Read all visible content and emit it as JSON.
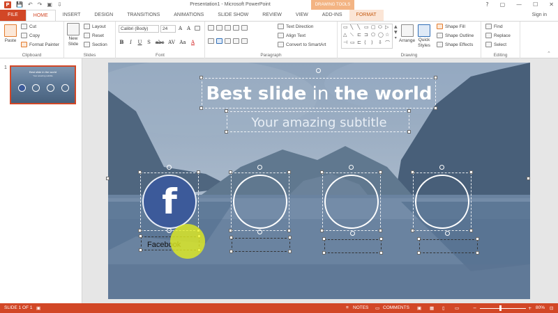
{
  "window": {
    "title": "Presentation1 - Microsoft PowerPoint",
    "app_icon": "P",
    "contextual_header": "DRAWING TOOLS",
    "signin": "Sign in",
    "controls": [
      "?",
      "▢",
      "—",
      "☐",
      "✕"
    ]
  },
  "quick_access": [
    "💾",
    "↶",
    "↷",
    "▣",
    "⇩"
  ],
  "tabs": [
    "FILE",
    "HOME",
    "INSERT",
    "DESIGN",
    "TRANSITIONS",
    "ANIMATIONS",
    "SLIDE SHOW",
    "REVIEW",
    "VIEW",
    "ADD-INS",
    "FORMAT"
  ],
  "ribbon": {
    "clipboard": {
      "label": "Clipboard",
      "paste": "Paste",
      "cut": "Cut",
      "copy": "Copy",
      "format_painter": "Format Painter"
    },
    "slides": {
      "label": "Slides",
      "new_slide_1": "New",
      "new_slide_2": "Slide",
      "layout": "Layout",
      "reset": "Reset",
      "section": "Section"
    },
    "font": {
      "label": "Font",
      "family": "Calibri (Body)",
      "size": "24",
      "buttons": [
        "B",
        "I",
        "U",
        "S",
        "abc",
        "AV",
        "Aa",
        "A"
      ]
    },
    "paragraph": {
      "label": "Paragraph",
      "text_direction": "Text Direction",
      "align_text": "Align Text",
      "convert": "Convert to SmartArt"
    },
    "drawing": {
      "label": "Drawing",
      "shapes": [
        "▭",
        "╲",
        "╲",
        "▭",
        "▢",
        "⬭",
        "▷",
        "△",
        "⟍",
        "⊏",
        "⊐",
        "⬠",
        "◯",
        "☆",
        "⊣",
        "▭",
        "⊏",
        "⟨",
        "⟩",
        "⇩",
        "⌒",
        "◠",
        "⌒",
        "↗",
        "↗",
        "⤴",
        "⇧",
        "⤶"
      ],
      "arrange": "Arrange",
      "quick_styles_1": "Quick",
      "quick_styles_2": "Styles",
      "shape_fill": "Shape Fill",
      "shape_outline": "Shape Outline",
      "shape_effects": "Shape Effects"
    },
    "editing": {
      "label": "Editing",
      "find": "Find",
      "replace": "Replace",
      "select": "Select"
    }
  },
  "thumbnail": {
    "number": "1",
    "title": "Best slide in the world",
    "subtitle": "Your amazing subtitle"
  },
  "slide": {
    "title_bold": "Best slide",
    "title_light": " in ",
    "title_bold2": "the world",
    "subtitle": "Your amazing subtitle",
    "facebook_icon": "f",
    "label_1": "Facebook"
  },
  "status_bar": {
    "slide_info": "SLIDE 1 OF 1",
    "notes": "NOTES",
    "comments": "COMMENTS",
    "zoom_minus": "−",
    "zoom_plus": "+",
    "zoom": "80%"
  },
  "colors": {
    "accent": "#d24726",
    "facebook": "#3c5a9a",
    "cursor_highlight": "#e6f01e"
  }
}
